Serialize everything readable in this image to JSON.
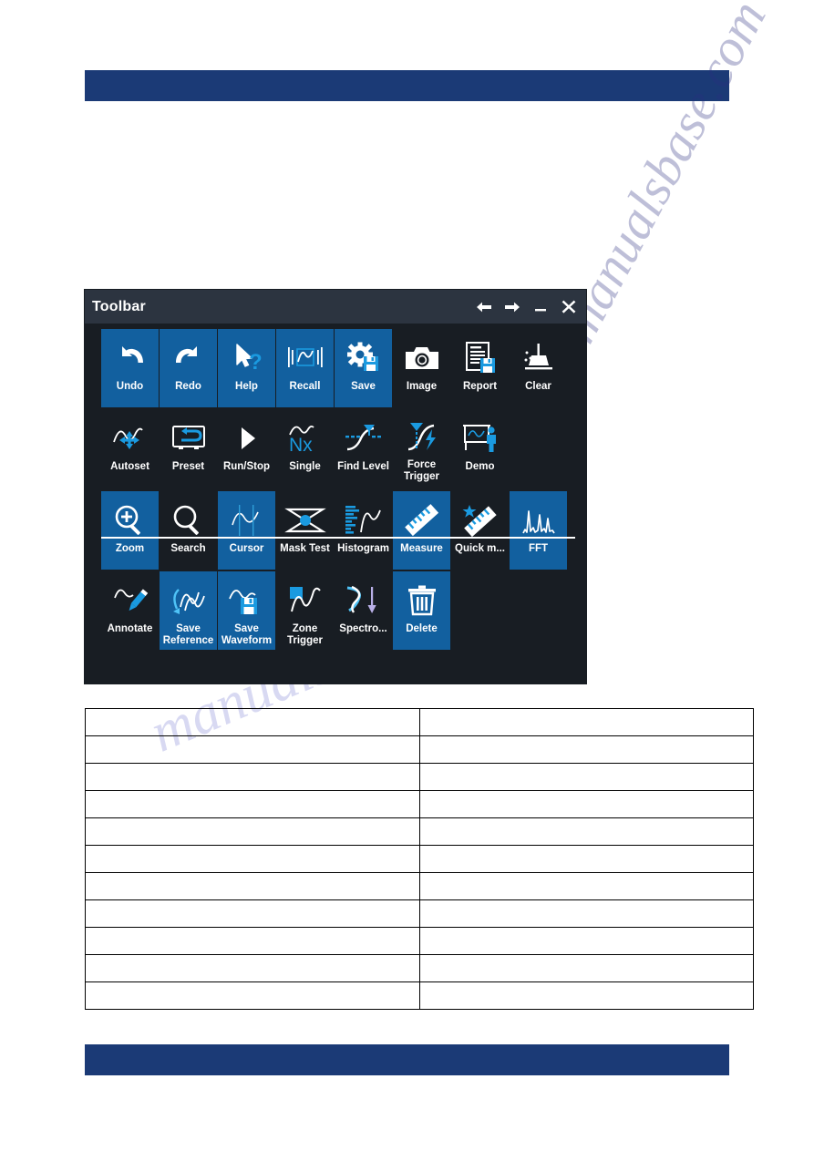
{
  "document": {
    "top_bar": {
      "text": "",
      "color": "#1b3a76"
    },
    "bottom_bar": {
      "text": "",
      "color": "#1b3a76"
    },
    "watermarks": [
      {
        "text": "manualsbase.com"
      },
      {
        "text": "manualsbase.com"
      }
    ]
  },
  "toolbar_window": {
    "title": "Toolbar",
    "title_bar_buttons": [
      {
        "name": "back-arrow-icon",
        "glyph": "←",
        "label": "Back"
      },
      {
        "name": "forward-arrow-icon",
        "glyph": "→",
        "label": "Forward"
      },
      {
        "name": "minimize-icon",
        "glyph": "—",
        "label": "Minimize"
      },
      {
        "name": "close-icon",
        "glyph": "✕",
        "label": "Close"
      }
    ],
    "selected_color": "#12609f",
    "background_color": "#181d23",
    "titlebar_color": "#2c3440",
    "accent_color": "#1a9ae0",
    "rows": [
      {
        "row": 1,
        "tiles": [
          {
            "label": "Undo",
            "icon": "undo-arrow-icon",
            "selected": true
          },
          {
            "label": "Redo",
            "icon": "redo-arrow-icon",
            "selected": true
          },
          {
            "label": "Help",
            "icon": "cursor-question-icon",
            "selected": true
          },
          {
            "label": "Recall",
            "icon": "recall-waveform-icon",
            "selected": true
          },
          {
            "label": "Save",
            "icon": "gear-floppy-icon",
            "selected": true
          },
          {
            "label": "Image",
            "icon": "camera-icon",
            "selected": false
          },
          {
            "label": "Report",
            "icon": "document-floppy-icon",
            "selected": false
          },
          {
            "label": "Clear",
            "icon": "broom-icon",
            "selected": false
          }
        ]
      },
      {
        "row": 2,
        "tiles": [
          {
            "label": "Autoset",
            "icon": "autoset-move-icon",
            "selected": false
          },
          {
            "label": "Preset",
            "icon": "preset-loop-icon",
            "selected": false
          },
          {
            "label": "Run/Stop",
            "icon": "play-triangle-icon",
            "selected": false
          },
          {
            "label": "Single",
            "icon": "single-nx-icon",
            "selected": false
          },
          {
            "label": "Find Level",
            "icon": "find-level-icon",
            "selected": false
          },
          {
            "label": "Force Trigger",
            "icon": "force-trigger-icon",
            "selected": false
          },
          {
            "label": "Demo",
            "icon": "demo-presenter-icon",
            "selected": false
          }
        ]
      },
      {
        "row": 3,
        "tiles": [
          {
            "label": "Zoom",
            "icon": "magnifier-plus-icon",
            "selected": true
          },
          {
            "label": "Search",
            "icon": "magnifier-icon",
            "selected": false
          },
          {
            "label": "Cursor",
            "icon": "cursor-lines-icon",
            "selected": true
          },
          {
            "label": "Mask Test",
            "icon": "mask-eye-icon",
            "selected": false
          },
          {
            "label": "Histogram",
            "icon": "histogram-icon",
            "selected": false
          },
          {
            "label": "Measure",
            "icon": "ruler-icon",
            "selected": true
          },
          {
            "label": "Quick m...",
            "icon": "ruler-star-icon",
            "selected": false
          },
          {
            "label": "FFT",
            "icon": "fft-peaks-icon",
            "selected": true
          }
        ]
      },
      {
        "row": 4,
        "tiles": [
          {
            "label": "Annotate",
            "icon": "pencil-annotate-icon",
            "selected": false
          },
          {
            "label": "Save Reference",
            "icon": "save-reference-icon",
            "selected": true
          },
          {
            "label": "Save Waveform",
            "icon": "save-waveform-icon",
            "selected": true
          },
          {
            "label": "Zone Trigger",
            "icon": "zone-trigger-icon",
            "selected": false
          },
          {
            "label": "Spectro...",
            "icon": "spectrogram-icon",
            "selected": false
          },
          {
            "label": "Delete",
            "icon": "trash-icon",
            "selected": true
          }
        ]
      }
    ]
  },
  "table": {
    "rows": [
      {
        "cells": [
          "",
          ""
        ]
      },
      {
        "cells": [
          "",
          ""
        ]
      },
      {
        "cells": [
          "",
          ""
        ]
      },
      {
        "cells": [
          "",
          ""
        ]
      },
      {
        "cells": [
          "",
          ""
        ]
      },
      {
        "cells": [
          "",
          ""
        ]
      },
      {
        "cells": [
          "",
          ""
        ]
      },
      {
        "cells": [
          "",
          ""
        ]
      },
      {
        "cells": [
          "",
          ""
        ]
      },
      {
        "cells": [
          "",
          ""
        ]
      },
      {
        "cells": [
          "",
          ""
        ]
      }
    ]
  }
}
